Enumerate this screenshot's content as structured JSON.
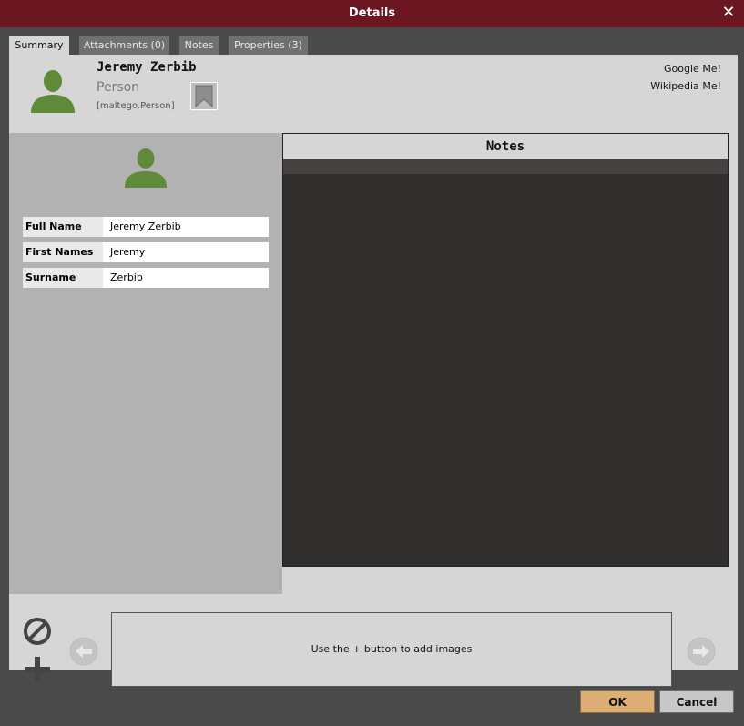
{
  "window": {
    "title": "Details",
    "close_icon": "close-icon"
  },
  "tabs": [
    {
      "label": "Summary",
      "active": true
    },
    {
      "label": "Attachments (0)",
      "active": false
    },
    {
      "label": "Notes",
      "active": false
    },
    {
      "label": "Properties (3)",
      "active": false
    }
  ],
  "entity": {
    "name": "Jeremy Zerbib",
    "type": "Person",
    "type_id": "[maltego.Person]",
    "icon": "person-icon",
    "icon_color": "#5e8a3a"
  },
  "links": [
    "Google Me!",
    "Wikipedia Me!"
  ],
  "properties": [
    {
      "key": "Full Name",
      "value": "Jeremy Zerbib"
    },
    {
      "key": "First Names",
      "value": "Jeremy"
    },
    {
      "key": "Surname",
      "value": "Zerbib"
    }
  ],
  "notes": {
    "header": "Notes"
  },
  "gallery": {
    "hint": "Use the + button to add images"
  },
  "buttons": {
    "ok": "OK",
    "cancel": "Cancel"
  },
  "colors": {
    "titlebar": "#6b1620",
    "ok_button": "#dcae73",
    "notes_bg": "#312e2e"
  }
}
